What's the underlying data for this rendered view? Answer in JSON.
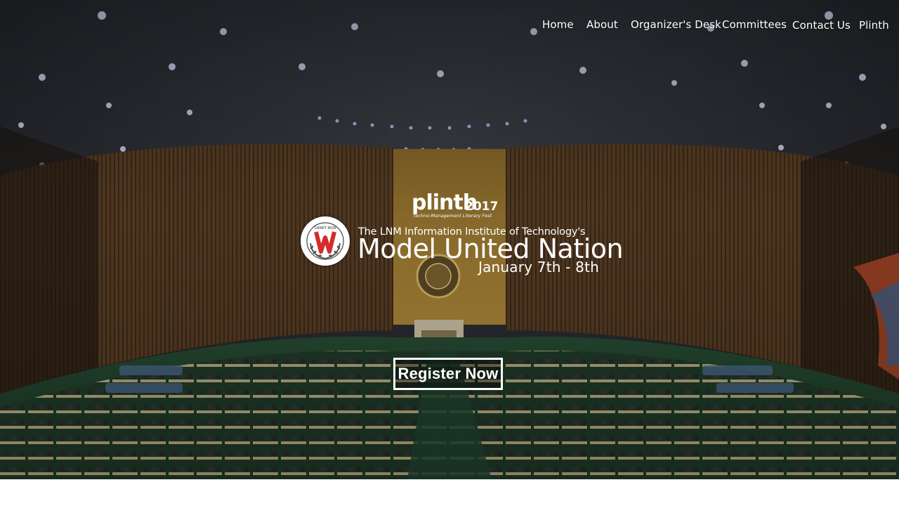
{
  "nav": {
    "items": [
      {
        "label": "Home"
      },
      {
        "label": "About"
      },
      {
        "label": "Organizer's Desk"
      },
      {
        "label": "Committees"
      },
      {
        "label": "Contact Us"
      },
      {
        "label": "Plinth"
      }
    ]
  },
  "brand": {
    "name": "plinth",
    "year": "2017",
    "tagline": "Techno-Management Literary Fest"
  },
  "hero": {
    "institute": "The LNM Information Institute of Technology's",
    "title": "Model United Nation",
    "date": "January 7th - 8th",
    "cta_label": "Register Now",
    "emblem_text": "LNMIIT MUN"
  },
  "colors": {
    "text": "#ffffff",
    "emblem_red": "#d52b2b",
    "hall_green": "#2f5a3a",
    "hall_wood": "#6b4a2a"
  }
}
